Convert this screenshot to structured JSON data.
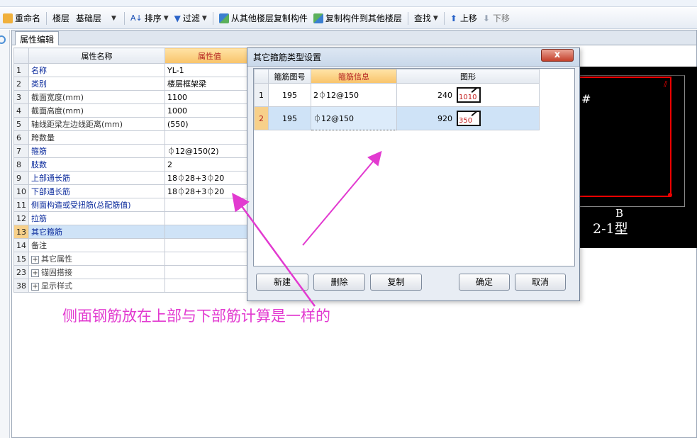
{
  "toolbar": {
    "rename": "重命名",
    "floor_label": "楼层",
    "floor_value": "基础层",
    "sort": "排序",
    "filter": "过滤",
    "copy_from": "从其他楼层复制构件",
    "copy_to": "复制构件到其他楼层",
    "find": "查找",
    "move_up": "上移",
    "move_down": "下移"
  },
  "panel": {
    "tab": "属性编辑",
    "col_name": "属性名称",
    "col_value": "属性值",
    "rows": [
      {
        "n": "1",
        "name": "名称",
        "value": "YL-1"
      },
      {
        "n": "2",
        "name": "类别",
        "value": "楼层框架梁"
      },
      {
        "n": "3",
        "name": "截面宽度(mm)",
        "value": "1100"
      },
      {
        "n": "4",
        "name": "截面高度(mm)",
        "value": "1000"
      },
      {
        "n": "5",
        "name": "轴线距梁左边线距离(mm)",
        "value": "(550)"
      },
      {
        "n": "6",
        "name": "跨数量",
        "value": ""
      },
      {
        "n": "7",
        "name": "箍筋",
        "value": "⏀12@150(2)"
      },
      {
        "n": "8",
        "name": "肢数",
        "value": "2"
      },
      {
        "n": "9",
        "name": "上部通长筋",
        "value": "18⏀28+3⏀20"
      },
      {
        "n": "10",
        "name": "下部通长筋",
        "value": "18⏀28+3⏀20"
      },
      {
        "n": "11",
        "name": "侧面构造或受扭筋(总配筋值)",
        "value": ""
      },
      {
        "n": "12",
        "name": "拉筋",
        "value": ""
      },
      {
        "n": "13",
        "name": "其它箍筋",
        "value": ""
      },
      {
        "n": "14",
        "name": "备注",
        "value": ""
      }
    ],
    "groups": [
      {
        "n": "15",
        "name": "其它属性"
      },
      {
        "n": "23",
        "name": "锚固搭接"
      },
      {
        "n": "38",
        "name": "显示样式"
      }
    ]
  },
  "dialog": {
    "title": "其它箍筋类型设置",
    "close": "x",
    "col_fig": "箍筋图号",
    "col_info": "箍筋信息",
    "col_shape": "图形",
    "rows": [
      {
        "n": "1",
        "fig": "195",
        "info": "2⏀12@150",
        "dim": "240",
        "shape_val": "1010"
      },
      {
        "n": "2",
        "fig": "195",
        "info": "⏀12@150",
        "dim": "920",
        "shape_val": "350"
      }
    ],
    "buttons": {
      "new": "新建",
      "delete": "删除",
      "copy": "复制",
      "ok": "确定",
      "cancel": "取消"
    }
  },
  "viewport": {
    "hash": "#",
    "label_b": "B",
    "label_type": "2-1型"
  },
  "annotation": {
    "text": "侧面钢筋放在上部与下部筋计算是一样的",
    "color": "#e23ad0"
  }
}
